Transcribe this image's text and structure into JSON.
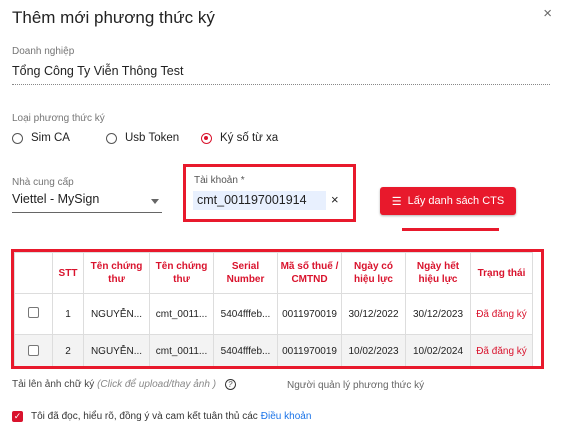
{
  "dialog": {
    "title": "Thêm mới phương thức ký",
    "close_glyph": "×"
  },
  "company": {
    "label": "Doanh nghiệp",
    "value": "Tổng Công Ty Viễn Thông Test"
  },
  "method": {
    "label": "Loại phương thức ký",
    "options": [
      {
        "label": "Sim CA",
        "selected": false
      },
      {
        "label": "Usb Token",
        "selected": false
      },
      {
        "label": "Ký số từ xa",
        "selected": true
      }
    ]
  },
  "provider": {
    "label": "Nhà cung cấp",
    "value": "Viettel - MySign"
  },
  "account": {
    "label": "Tài khoản *",
    "value": "cmt_001197001914",
    "clear_glyph": "×"
  },
  "cts_button": {
    "icon": "list-icon",
    "label": "Lấy danh sách CTS"
  },
  "table": {
    "headers": [
      "STT",
      "Tên chứng thư",
      "Tên chứng thư",
      "Serial Number",
      "Mã số thuế / CMTND",
      "Ngày có hiệu lực",
      "Ngày hết hiệu lực",
      "Trạng thái"
    ],
    "rows": [
      {
        "stt": "1",
        "ten1": "NGUYỄN...",
        "ten2": "cmt_0011...",
        "serial": "5404fffeb...",
        "mst": "0011970019",
        "from": "30/12/2022",
        "to": "30/12/2023",
        "status": "Đã đăng ký"
      },
      {
        "stt": "2",
        "ten1": "NGUYỄN...",
        "ten2": "cmt_0011...",
        "serial": "5404fffeb...",
        "mst": "0011970019",
        "from": "10/02/2023",
        "to": "10/02/2024",
        "status": "Đã đăng ký"
      }
    ]
  },
  "upload": {
    "label": "Tải lên ảnh chữ ký",
    "hint": "(Click để upload/thay ảnh )",
    "help_glyph": "?"
  },
  "manager_label": "Người quản lý phương thức ký",
  "agree": {
    "text": "Tôi đã đọc, hiểu rõ, đồng ý và cam kết tuân thủ các",
    "link": "Điều khoản",
    "checked": true
  },
  "colors": {
    "accent": "#e8192c",
    "link": "#1a73e8"
  }
}
